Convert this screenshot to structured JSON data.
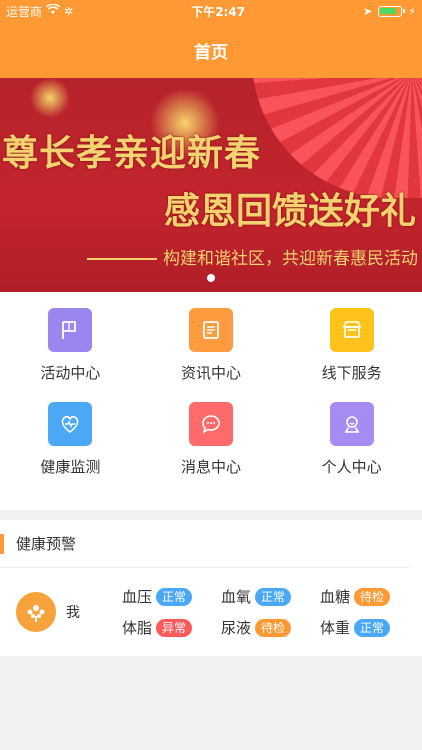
{
  "status_bar": {
    "carrier": "运营商",
    "time": "下午2:47"
  },
  "nav": {
    "title": "首页"
  },
  "banner": {
    "line1": "尊长孝亲迎新春",
    "line2": "感恩回馈送好礼",
    "line3": "构建和谐社区，共迎新春惠民活动"
  },
  "menu": [
    {
      "label": "活动中心",
      "icon": "flag-icon",
      "color": "#9b86f0"
    },
    {
      "label": "资讯中心",
      "icon": "news-icon",
      "color": "#ff9b3f"
    },
    {
      "label": "线下服务",
      "icon": "store-icon",
      "color": "#ffc21a"
    },
    {
      "label": "健康监测",
      "icon": "heart-monitor-icon",
      "color": "#4aa8f5"
    },
    {
      "label": "消息中心",
      "icon": "chat-bubble-icon",
      "color": "#ff6a6a"
    },
    {
      "label": "个人中心",
      "icon": "person-icon",
      "color": "#a58bf2"
    }
  ],
  "health": {
    "title": "健康预警",
    "user": "我",
    "metrics": [
      {
        "name": "血压",
        "status": "正常",
        "color": "#4aa8f5"
      },
      {
        "name": "血氧",
        "status": "正常",
        "color": "#4aa8f5"
      },
      {
        "name": "血糖",
        "status": "待检",
        "color": "#ff9933"
      },
      {
        "name": "体脂",
        "status": "异常",
        "color": "#ff5a5a"
      },
      {
        "name": "尿液",
        "status": "待检",
        "color": "#ff9933"
      },
      {
        "name": "体重",
        "status": "正常",
        "color": "#4aa8f5"
      }
    ]
  }
}
